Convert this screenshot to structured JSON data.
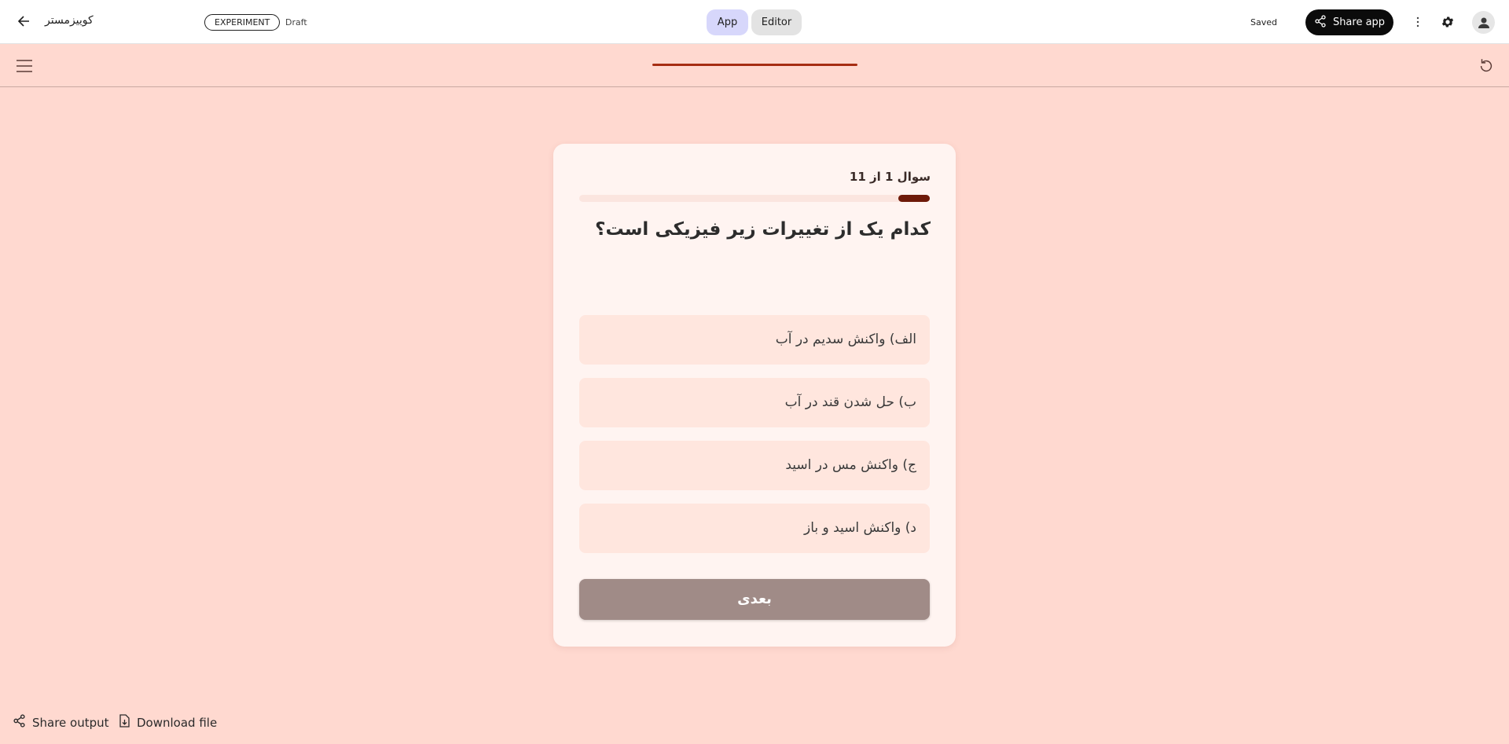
{
  "topbar": {
    "app_title": "کوییزمستر",
    "badge": "EXPERIMENT",
    "status": "Draft",
    "modes": {
      "app": "App",
      "editor": "Editor"
    },
    "save_status": "Saved",
    "share_label": "Share app"
  },
  "quiz": {
    "counter": "سوال 1 از 11",
    "progress": 0.09,
    "question": "کدام یک از تغییرات زیر فیزیکی است؟",
    "options": [
      "الف) واکنش سدیم در آب",
      "ب) حل شدن قند در آب",
      "ج) واکنش مس در اسید",
      "د) واکنش اسید و باز"
    ],
    "next_label": "بعدی"
  },
  "footer": {
    "share_output": "Share output",
    "download_file": "Download file"
  },
  "colors": {
    "background": "#ffd9d0",
    "accent": "#a62d12",
    "progress_fill": "#6e1a09",
    "button_disabled": "#a08b87"
  }
}
